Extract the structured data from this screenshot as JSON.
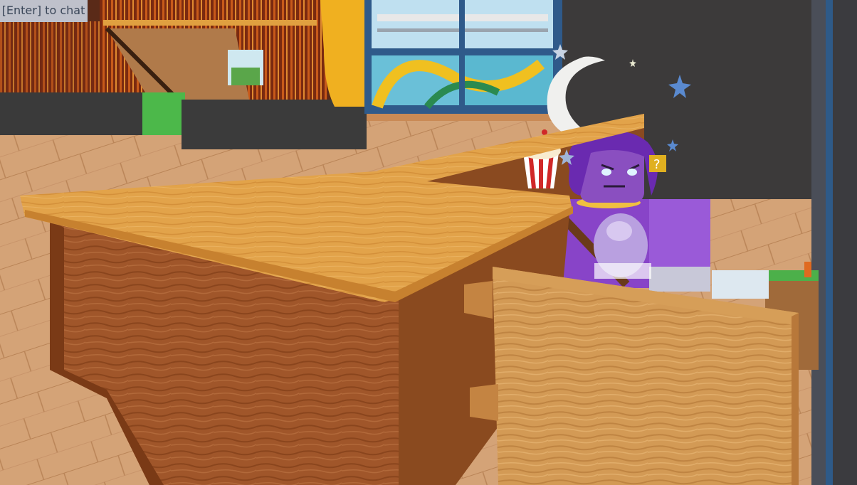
{
  "chat": {
    "hint_label": "[Enter] to chat"
  },
  "scene": {
    "floor_color": "#d6a57a",
    "desk_top_color": "#e1a24a",
    "desk_front_color": "#9a4f22",
    "avatar_body_color": "#8844c8",
    "avatar_skin_color": "#8a4fc0",
    "crescent_color": "#f0f0ee",
    "rail_blue": "#335a8c"
  }
}
